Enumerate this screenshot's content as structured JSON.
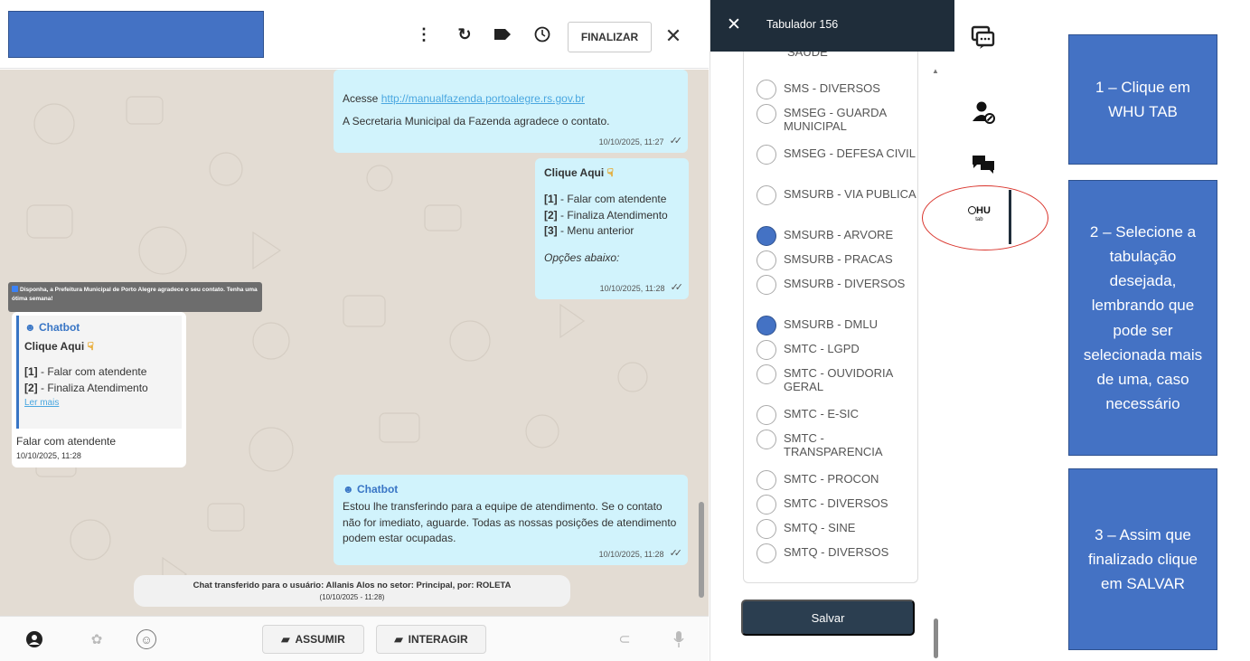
{
  "chat": {
    "header": {
      "finalizar_label": "FINALIZAR"
    },
    "messages": {
      "m1": {
        "line_prefix": "Acesse ",
        "link": "http://manualfazenda.portoalegre.rs.gov.br",
        "line2": "A Secretaria Municipal da Fazenda  agradece o contato.",
        "time": "10/10/2025, 11:27"
      },
      "m2": {
        "title": "Clique Aqui",
        "opt1_num": "[1]",
        "opt1": " - Falar com atendente",
        "opt2_num": "[2]",
        "opt2": " - Finaliza Atendimento",
        "opt3_num": "[3]",
        "opt3": " - Menu anterior",
        "footer": "Opções abaixo:",
        "time": "10/10/2025, 11:28"
      },
      "notice": "Disponha, a Prefeitura Municipal de Porto Alegre agradece o seu contato. Tenha uma ótima semana!",
      "m3": {
        "sender": "Chatbot",
        "title": "Clique Aqui",
        "opt1_num": "[1]",
        "opt1": " - Falar com atendente",
        "opt2_num": "[2]",
        "opt2": " - Finaliza Atendimento",
        "ler_mais": "Ler mais",
        "reply": "Falar com atendente",
        "time": "10/10/2025, 11:28"
      },
      "m4": {
        "sender": "Chatbot",
        "text": "Estou lhe transferindo para a equipe de atendimento. Se o contato não for imediato, aguarde. Todas as nossas posições de atendimento podem estar ocupadas.",
        "time": "10/10/2025, 11:28"
      },
      "transfer": {
        "line1": "Chat transferido para o usuário: Allanis Alos no setor: Principal, por: ROLETA",
        "line2": "(10/10/2025 - 11:28)"
      }
    },
    "footer": {
      "assumir_label": "ASSUMIR",
      "interagir_label": "INTERAGIR"
    }
  },
  "tabulador": {
    "title": "Tabulador 156",
    "partial_top": "SAUDE",
    "options": [
      {
        "label": "SMS - DIVERSOS",
        "selected": false
      },
      {
        "label": "SMSEG - GUARDA MUNICIPAL",
        "selected": false
      },
      {
        "label": "SMSEG - DEFESA CIVIL",
        "selected": false
      },
      {
        "label": "SMSURB - VIA PUBLICA",
        "selected": false
      },
      {
        "label": "SMSURB - ARVORE",
        "selected": true
      },
      {
        "label": "SMSURB - PRACAS",
        "selected": false
      },
      {
        "label": "SMSURB - DIVERSOS",
        "selected": false
      },
      {
        "label": "SMSURB - DMLU",
        "selected": true
      },
      {
        "label": "SMTC - LGPD",
        "selected": false
      },
      {
        "label": "SMTC - OUVIDORIA GERAL",
        "selected": false
      },
      {
        "label": "SMTC - E-SIC",
        "selected": false
      },
      {
        "label": "SMTC - TRANSPARENCIA",
        "selected": false
      },
      {
        "label": "SMTC - PROCON",
        "selected": false
      },
      {
        "label": "SMTC - DIVERSOS",
        "selected": false
      },
      {
        "label": "SMTQ - SINE",
        "selected": false
      },
      {
        "label": "SMTQ - DIVERSOS",
        "selected": false
      }
    ],
    "save_label": "Salvar"
  },
  "rail": {
    "whu_text": "HU",
    "whu_sub": "tab"
  },
  "instructions": {
    "step1": "1 – Clique em WHU TAB",
    "step2": "2 – Selecione a tabulação desejada, lembrando que pode ser selecionada mais de uma, caso necessário",
    "step3": "3 – Assim que finalizado clique em SALVAR"
  },
  "colors": {
    "outgoing_bubble": "#d1f3fc",
    "chat_background": "#e3dcd3",
    "tab_header": "#1f2d3a",
    "save_button": "#2b3e50",
    "instruction_box": "#4472c4",
    "selected_radio": "#4472c4",
    "highlight_circle": "#d9332b"
  }
}
